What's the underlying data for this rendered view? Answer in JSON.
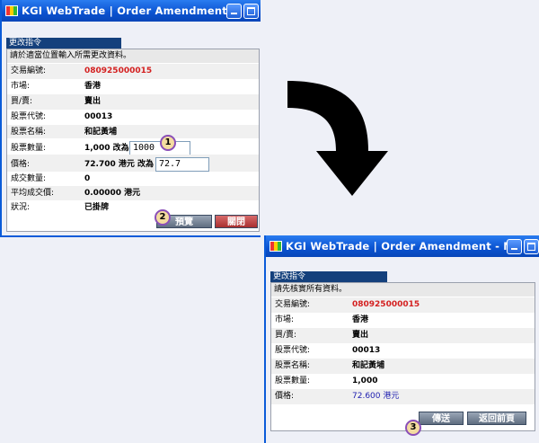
{
  "window_title": "KGI WebTrade | Order Amendment - Micros...",
  "left": {
    "heading": "更改指令",
    "instruction": "請於適當位置輸入所需更改資料。",
    "rows": [
      {
        "label": "交易編號:",
        "value": "080925000015"
      },
      {
        "label": "市場:",
        "value": "香港"
      },
      {
        "label": "買/賣:",
        "value": "賣出"
      },
      {
        "label": "股票代號:",
        "value": "00013"
      },
      {
        "label": "股票名稱:",
        "value": "和記黃埔"
      },
      {
        "label": "股票數量:",
        "value": "1,000",
        "suffix": "改為",
        "input": "1000"
      },
      {
        "label": "價格:",
        "value": "72.700",
        "suffix": "港元 改為",
        "input": "72.7"
      },
      {
        "label": "成交數量:",
        "value": "0"
      },
      {
        "label": "平均成交價:",
        "value": "0.00000 港元"
      },
      {
        "label": "狀況:",
        "value": "已掛牌"
      }
    ],
    "buttons": {
      "preview": "預覽",
      "close": "關閉"
    }
  },
  "right": {
    "heading": "更改指令",
    "instruction": "請先核實所有資料。",
    "rows": [
      {
        "label": "交易編號:",
        "value": "080925000015"
      },
      {
        "label": "市場:",
        "value": "香港"
      },
      {
        "label": "買/賣:",
        "value": "賣出"
      },
      {
        "label": "股票代號:",
        "value": "00013"
      },
      {
        "label": "股票名稱:",
        "value": "和記黃埔"
      },
      {
        "label": "股票數量:",
        "value": "1,000"
      },
      {
        "label": "價格:",
        "value": "72.600 港元"
      }
    ],
    "buttons": {
      "send": "傳送",
      "back": "返回前頁"
    }
  },
  "markers": [
    "1",
    "2",
    "3"
  ],
  "colors": {
    "titlebar": "#0a52d0",
    "heading": "#14407c",
    "red_value": "#d42020",
    "marker_border": "#8a4fb8"
  }
}
